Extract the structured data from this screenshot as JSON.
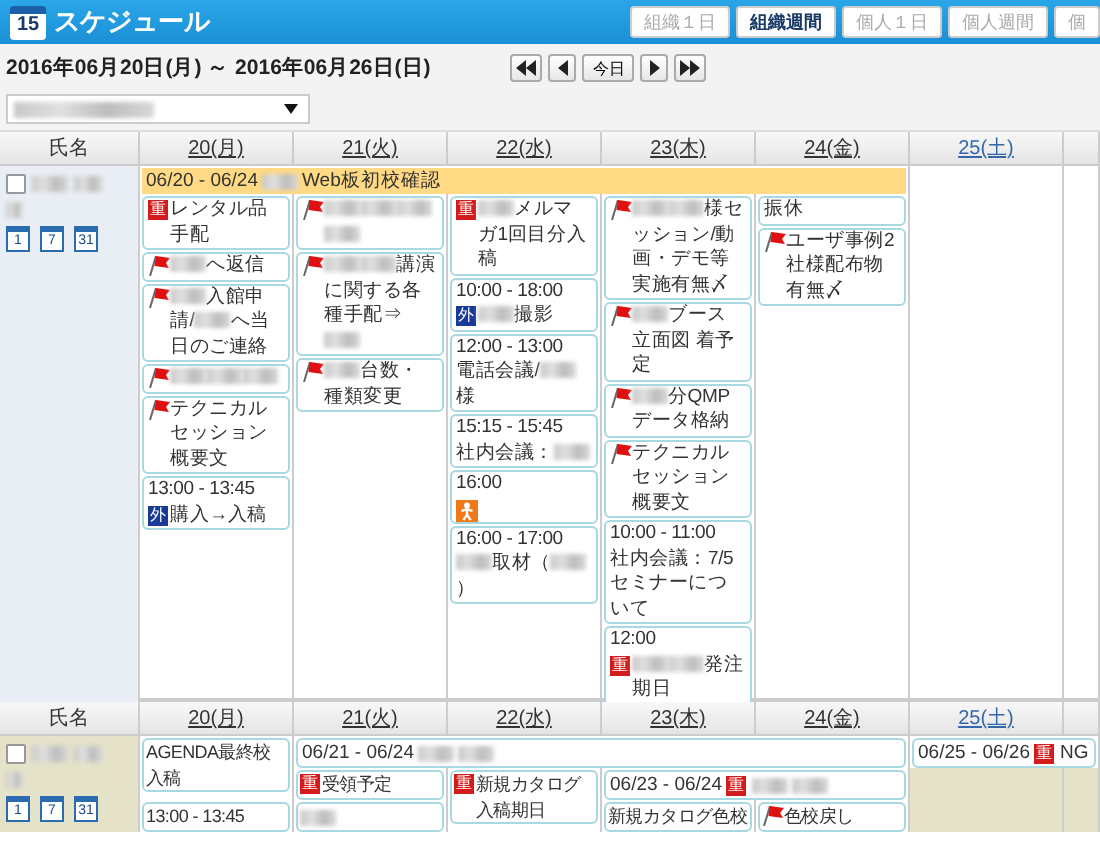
{
  "header": {
    "icon_day": "15",
    "title": "スケジュール",
    "views": [
      {
        "label": "組織１日",
        "selected": false
      },
      {
        "label": "組織週間",
        "selected": true
      },
      {
        "label": "個人１日",
        "selected": false
      },
      {
        "label": "個人週間",
        "selected": false
      },
      {
        "label": "個",
        "selected": false
      }
    ]
  },
  "range": {
    "text": "2016年06月20日(月) ～ 2016年06月26日(日)",
    "today": "今日"
  },
  "sections": [
    {
      "kind": "blue",
      "name_header": "氏名",
      "days": [
        {
          "label": "20(月)",
          "kind": "weekday"
        },
        {
          "label": "21(火)",
          "kind": "weekday"
        },
        {
          "label": "22(水)",
          "kind": "weekday"
        },
        {
          "label": "23(木)",
          "kind": "weekday"
        },
        {
          "label": "24(金)",
          "kind": "weekday"
        },
        {
          "label": "25(土)",
          "kind": "saturday"
        }
      ],
      "view_icons": [
        "1",
        "7",
        "31"
      ],
      "checked": false,
      "lanes": [
        [
          {
            "kind": "banner_highlight",
            "parts": [
              {
                "kind": "text",
                "text": "06/20 - 06/24"
              },
              {
                "kind": "blur"
              },
              {
                "kind": "text",
                "text": "Web板初校確認"
              }
            ]
          },
          {
            "kind": "continued"
          },
          {
            "kind": "continued"
          },
          {
            "kind": "continued"
          },
          {
            "kind": "continued"
          },
          {
            "kind": "empty",
            "shaded": false
          },
          {
            "kind": "empty",
            "shaded": false
          }
        ],
        [
          {
            "kind": "cell",
            "events": [
              {
                "kind": "important",
                "badge": "重",
                "parts": [
                  {
                    "kind": "text",
                    "text": "レンタル品手配"
                  }
                ]
              },
              {
                "kind": "flag",
                "parts": [
                  {
                    "kind": "blur"
                  },
                  {
                    "kind": "text",
                    "text": "へ返信"
                  }
                ]
              },
              {
                "kind": "flag",
                "parts": [
                  {
                    "kind": "blur"
                  },
                  {
                    "kind": "text",
                    "text": "入館申請/"
                  },
                  {
                    "kind": "blur"
                  },
                  {
                    "kind": "text",
                    "text": "へ当日のご連絡"
                  }
                ]
              },
              {
                "kind": "flag",
                "parts": [
                  {
                    "kind": "blur"
                  },
                  {
                    "kind": "blur"
                  },
                  {
                    "kind": "blur"
                  }
                ]
              },
              {
                "kind": "flag",
                "parts": [
                  {
                    "kind": "text",
                    "text": "テクニカルセッション概要文"
                  }
                ]
              },
              {
                "kind": "outside",
                "time": "13:00 - 13:45",
                "badge": "外",
                "parts": [
                  {
                    "kind": "text",
                    "text": "購入→入稿"
                  }
                ]
              }
            ]
          },
          {
            "kind": "cell",
            "events": [
              {
                "kind": "flag",
                "parts": [
                  {
                    "kind": "blur"
                  },
                  {
                    "kind": "blur"
                  },
                  {
                    "kind": "blur"
                  },
                  {
                    "kind": "blur"
                  }
                ]
              },
              {
                "kind": "flag",
                "parts": [
                  {
                    "kind": "blur"
                  },
                  {
                    "kind": "blur"
                  },
                  {
                    "kind": "text",
                    "text": "講演に関する各種手配⇒"
                  },
                  {
                    "kind": "blur"
                  }
                ]
              },
              {
                "kind": "flag",
                "parts": [
                  {
                    "kind": "blur"
                  },
                  {
                    "kind": "text",
                    "text": "台数・種類変更"
                  }
                ]
              }
            ]
          },
          {
            "kind": "cell",
            "events": [
              {
                "kind": "important",
                "badge": "重",
                "parts": [
                  {
                    "kind": "blur"
                  },
                  {
                    "kind": "text",
                    "text": "メルマガ1回目分入稿"
                  }
                ]
              },
              {
                "kind": "outside",
                "time": "10:00 - 18:00",
                "badge": "外",
                "parts": [
                  {
                    "kind": "blur"
                  },
                  {
                    "kind": "text",
                    "text": "撮影"
                  }
                ]
              },
              {
                "kind": "plain",
                "time": "12:00 - 13:00",
                "parts": [
                  {
                    "kind": "text",
                    "text": "電話会議/"
                  },
                  {
                    "kind": "blur"
                  },
                  {
                    "kind": "text",
                    "text": "様"
                  }
                ]
              },
              {
                "kind": "plain",
                "time": "15:15 - 15:45",
                "parts": [
                  {
                    "kind": "text",
                    "text": "社内会議："
                  },
                  {
                    "kind": "blur"
                  }
                ]
              },
              {
                "kind": "person",
                "time": "16:00"
              },
              {
                "kind": "plain",
                "time": "16:00 - 17:00",
                "parts": [
                  {
                    "kind": "blur"
                  },
                  {
                    "kind": "text",
                    "text": "取材（"
                  },
                  {
                    "kind": "blur"
                  },
                  {
                    "kind": "text",
                    "text": "）"
                  }
                ]
              }
            ]
          },
          {
            "kind": "cell",
            "events": [
              {
                "kind": "flag",
                "parts": [
                  {
                    "kind": "blur"
                  },
                  {
                    "kind": "blur"
                  },
                  {
                    "kind": "text",
                    "text": "様セッション/動画・デモ等実施有無〆"
                  }
                ]
              },
              {
                "kind": "flag",
                "parts": [
                  {
                    "kind": "blur"
                  },
                  {
                    "kind": "text",
                    "text": "ブース立面図 着予定"
                  }
                ]
              },
              {
                "kind": "flag",
                "parts": [
                  {
                    "kind": "blur"
                  },
                  {
                    "kind": "text",
                    "text": "分QMPデータ格納"
                  }
                ]
              },
              {
                "kind": "flag",
                "parts": [
                  {
                    "kind": "text",
                    "text": "テクニカルセッション概要文"
                  }
                ]
              },
              {
                "kind": "plain",
                "time": "10:00 - 11:00",
                "parts": [
                  {
                    "kind": "text",
                    "text": "社内会議：7/5セミナーについて"
                  }
                ]
              },
              {
                "kind": "important",
                "time": "12:00",
                "badge": "重",
                "parts": [
                  {
                    "kind": "blur"
                  },
                  {
                    "kind": "blur"
                  },
                  {
                    "kind": "text",
                    "text": "発注期日"
                  }
                ]
              }
            ]
          },
          {
            "kind": "cell",
            "events": [
              {
                "kind": "plain",
                "parts": [
                  {
                    "kind": "text",
                    "text": "振休"
                  }
                ]
              },
              {
                "kind": "flag",
                "parts": [
                  {
                    "kind": "text",
                    "text": "ユーザ事例2社様配布物有無〆"
                  }
                ]
              }
            ]
          },
          {
            "kind": "empty",
            "shaded": false
          },
          {
            "kind": "empty",
            "shaded": false
          }
        ]
      ]
    },
    {
      "kind": "beige",
      "name_header": "氏名",
      "days": [
        {
          "label": "20(月)",
          "kind": "weekday"
        },
        {
          "label": "21(火)",
          "kind": "weekday"
        },
        {
          "label": "22(水)",
          "kind": "weekday"
        },
        {
          "label": "23(木)",
          "kind": "weekday"
        },
        {
          "label": "24(金)",
          "kind": "weekday"
        },
        {
          "label": "25(土)",
          "kind": "saturday"
        }
      ],
      "view_icons": [
        "1",
        "7",
        "31"
      ],
      "checked": false,
      "lanes": [
        [
          {
            "kind": "cell",
            "events": [
              {
                "kind": "plain",
                "parts": [
                  {
                    "kind": "text",
                    "text": "AGENDA最終校入稿"
                  }
                ]
              }
            ]
          },
          {
            "kind": "banner",
            "parts": [
              {
                "kind": "text",
                "text": "06/21 - 06/24"
              },
              {
                "kind": "blur"
              },
              {
                "kind": "blur"
              }
            ]
          },
          {
            "kind": "continued"
          },
          {
            "kind": "continued"
          },
          {
            "kind": "continued"
          },
          {
            "kind": "banner",
            "parts": [
              {
                "kind": "text",
                "text": "06/25 - 06/26"
              },
              {
                "kind": "badge",
                "text": "重"
              },
              {
                "kind": "text",
                "text": "NG"
              }
            ]
          },
          {
            "kind": "continued"
          }
        ],
        [
          {
            "kind": "wrapped"
          },
          {
            "kind": "cell",
            "events": [
              {
                "kind": "important",
                "badge": "重",
                "parts": [
                  {
                    "kind": "text",
                    "text": "受領予定"
                  }
                ]
              }
            ]
          },
          {
            "kind": "cell",
            "events": [
              {
                "kind": "important",
                "badge": "重",
                "parts": [
                  {
                    "kind": "text",
                    "text": "新規カタログ入稿期日"
                  }
                ]
              }
            ]
          },
          {
            "kind": "banner",
            "parts": [
              {
                "kind": "text",
                "text": "06/23 - 06/24"
              },
              {
                "kind": "badge",
                "text": "重"
              },
              {
                "kind": "blur"
              },
              {
                "kind": "blur"
              }
            ]
          },
          {
            "kind": "continued"
          },
          {
            "kind": "empty",
            "shaded": true
          },
          {
            "kind": "empty",
            "shaded": true
          }
        ],
        [
          {
            "kind": "cell",
            "events": [
              {
                "kind": "plain",
                "time": "13:00 - 13:45"
              }
            ]
          },
          {
            "kind": "cell",
            "events": [
              {
                "kind": "plain",
                "parts": [
                  {
                    "kind": "blur"
                  }
                ]
              }
            ]
          },
          {
            "kind": "wrapped"
          },
          {
            "kind": "cell",
            "events": [
              {
                "kind": "plain",
                "parts": [
                  {
                    "kind": "text",
                    "text": "新規カタログ色校"
                  }
                ]
              }
            ]
          },
          {
            "kind": "cell",
            "events": [
              {
                "kind": "flag",
                "parts": [
                  {
                    "kind": "text",
                    "text": "色校戻し"
                  }
                ]
              }
            ]
          },
          {
            "kind": "empty",
            "shaded": true
          },
          {
            "kind": "empty",
            "shaded": true
          }
        ]
      ]
    }
  ]
}
